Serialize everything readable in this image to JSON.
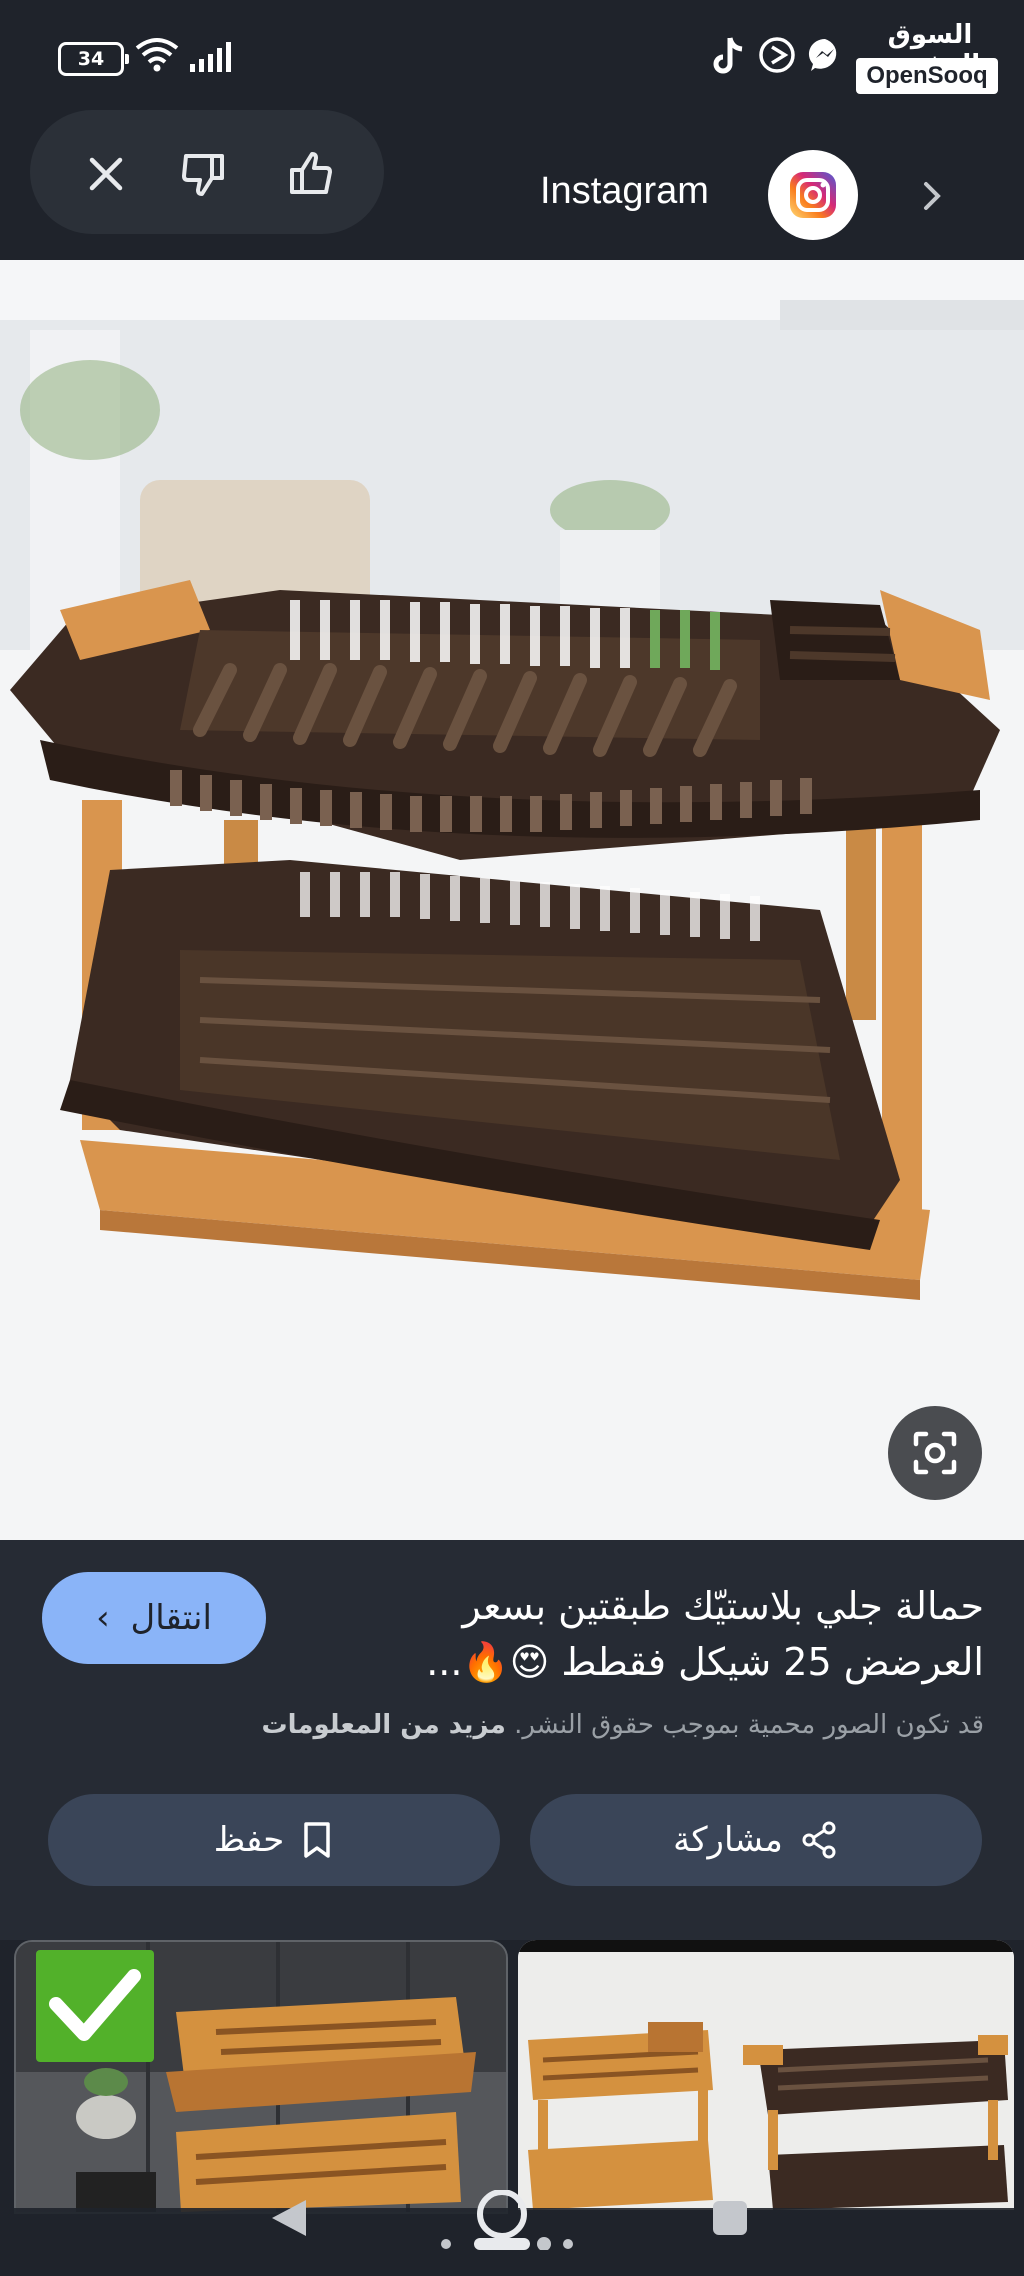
{
  "status_bar": {
    "battery": "34",
    "brand_arabic": "السوق المفتوح",
    "brand_latin": "OpenSooq",
    "app_icons": [
      "tiktok-icon",
      "play-circle-icon",
      "messenger-icon"
    ]
  },
  "top_bar": {
    "actions": [
      "close-icon",
      "thumbs-down-icon",
      "thumbs-up-icon"
    ],
    "source_name": "Instagram",
    "source_icon": "instagram-icon",
    "next_icon": "chevron-right-icon"
  },
  "result": {
    "title": "حمالة جلي بلاستيّك طبقتين بسعر العرضض 25 شيكل فقطط 😍🔥...",
    "visit_label": "انتقال",
    "copyright_note": "قد تكون الصور محمية بموجب حقوق النشر.",
    "more_info_label": "مزيد من المعلومات"
  },
  "actions": {
    "share_label": "مشاركة",
    "save_label": "حفظ"
  },
  "colors": {
    "background": "#1f232b",
    "panel": "#262b34",
    "visit_button": "#8ab4f8",
    "action_button": "#3a4558",
    "rack_brown": "#3b2a22",
    "rack_orange": "#d9954e"
  }
}
